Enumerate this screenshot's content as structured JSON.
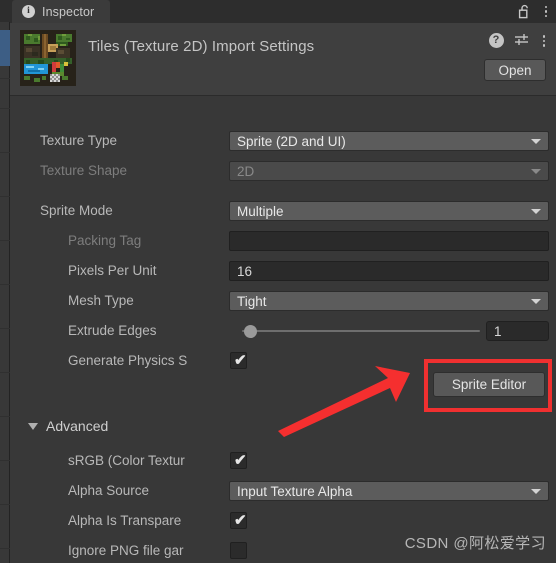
{
  "window": {
    "tab_label": "Inspector",
    "tab_icon": "info-icon",
    "lock_icon": "unlocked-padlock-icon",
    "tab_menu_icon": "kebab-menu-icon"
  },
  "object_header": {
    "title": "Tiles (Texture 2D) Import Settings",
    "thumbnail_name": "texture-preview-thumbnail",
    "help_icon": "help-icon",
    "preset_icon": "preset-sliders-icon",
    "menu_icon": "kebab-menu-icon",
    "open_button": "Open"
  },
  "properties": [
    {
      "label": "Texture Type",
      "type": "popup",
      "value": "Sprite (2D and UI)",
      "indent": 0,
      "disabled": false
    },
    {
      "label": "Texture Shape",
      "type": "popup",
      "value": "2D",
      "indent": 0,
      "disabled": true
    },
    {
      "label": "Sprite Mode",
      "type": "popup",
      "value": "Multiple",
      "indent": 0,
      "disabled": false
    },
    {
      "label": "Packing Tag",
      "type": "text",
      "value": "",
      "indent": 1,
      "disabled": true
    },
    {
      "label": "Pixels Per Unit",
      "type": "text",
      "value": "16",
      "indent": 1,
      "disabled": false
    },
    {
      "label": "Mesh Type",
      "type": "popup",
      "value": "Tight",
      "indent": 1,
      "disabled": false
    },
    {
      "label": "Extrude Edges",
      "type": "slider",
      "value": "1",
      "indent": 1,
      "disabled": false
    },
    {
      "label": "Generate Physics S",
      "type": "checkbox",
      "checked": true,
      "indent": 1,
      "disabled": false
    }
  ],
  "advanced": {
    "foldout_label": "Advanced",
    "expanded": true,
    "items": [
      {
        "label": "sRGB (Color Textur",
        "type": "checkbox",
        "checked": true,
        "indent": 1
      },
      {
        "label": "Alpha Source",
        "type": "popup",
        "value": "Input Texture Alpha",
        "indent": 1
      },
      {
        "label": "Alpha Is Transpare",
        "type": "checkbox",
        "checked": true,
        "indent": 1
      },
      {
        "label": "Ignore PNG file gar",
        "type": "checkbox",
        "checked": false,
        "indent": 1
      }
    ]
  },
  "annotation": {
    "sprite_editor_button": "Sprite Editor",
    "highlight_color": "#f03030",
    "arrow_color": "#f52f2f"
  },
  "watermark": "CSDN @阿松爱学习",
  "colors": {
    "panel_bg": "#383838",
    "header_bg": "#3f3f3f",
    "tabbar_bg": "#2d2d2d",
    "tab_active_bg": "#3b3b3b",
    "popup_bg": "#5c5c5c",
    "textfield_bg": "#2a2a2a",
    "selection_blue": "#3d5e85",
    "label_text": "#b8b8b8",
    "label_disabled": "#7d7d7d"
  }
}
